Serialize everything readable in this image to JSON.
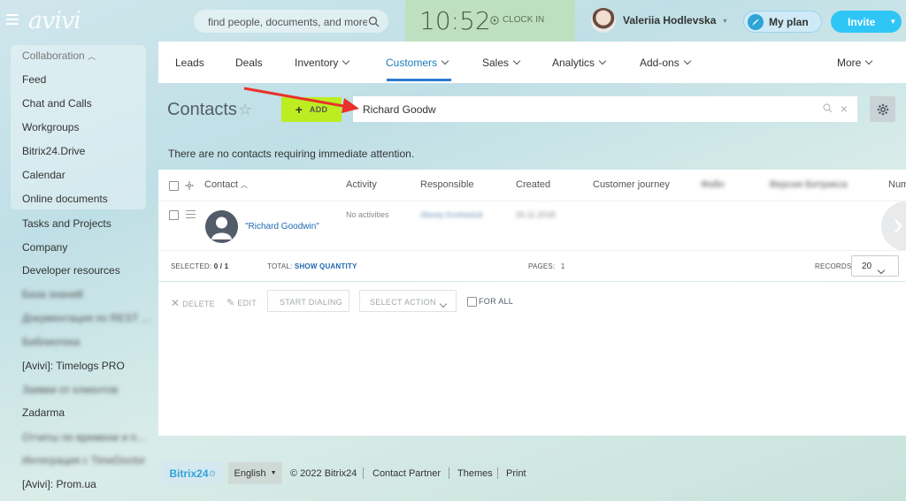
{
  "header": {
    "logo_text": "avivi",
    "search_placeholder": "find people, documents, and more",
    "clock_time": "10:52",
    "clock_in_label": "CLOCK IN",
    "user_name": "Valeriia Hodlevska",
    "plan_label": "My plan",
    "invite_label": "Invite"
  },
  "sidebar": {
    "header": "Collaboration",
    "items": [
      "Feed",
      "Chat and Calls",
      "Workgroups",
      "Bitrix24.Drive",
      "Calendar",
      "Online documents",
      "Tasks and Projects",
      "Company",
      "Developer resources",
      "База знаний",
      "Документация по REST ...",
      "Библиотека",
      "[Avivi]: Timelogs PRO",
      "Заявки от клиентов",
      "Zadarma",
      "Отчеты по времени и п...",
      "Интеграция с TimeDoctor",
      "[Avivi]: Prom.ua"
    ]
  },
  "tabs": [
    "Leads",
    "Deals",
    "Inventory",
    "Customers",
    "Sales",
    "Analytics",
    "Add-ons",
    "More"
  ],
  "page": {
    "title": "Contacts",
    "add_label": "ADD",
    "filter_value": "Richard Goodw",
    "notice": "There are no contacts requiring immediate attention."
  },
  "grid": {
    "columns": [
      "Contact",
      "Activity",
      "Responsible",
      "Created",
      "Customer journey",
      "Фейн",
      "Версия Битрикса",
      "Num"
    ],
    "rows": [
      {
        "contact": "\"Richard Goodwin\"",
        "activity": "No activities",
        "responsible": "Alexey Kovbasiuk",
        "created": "26.11.2018"
      }
    ],
    "footer": {
      "selected_label": "SELECTED:",
      "selected_value": "0 / 1",
      "total_label": "TOTAL:",
      "total_link": "SHOW QUANTITY",
      "pages_label": "PAGES:",
      "pages_value": "1",
      "records_label": "RECORDS:",
      "records_value": "20"
    }
  },
  "actions": {
    "delete": "DELETE",
    "edit": "EDIT",
    "start_dialing": "START DIALING",
    "select_action": "SELECT ACTION",
    "for_all": "FOR ALL"
  },
  "footer": {
    "logo_text": "Bitrix24",
    "language": "English",
    "copyright": "© 2022 Bitrix24",
    "links": [
      "Contact Partner",
      "Themes",
      "Print"
    ]
  },
  "colors": {
    "accent": "#2fc6f6",
    "add_button": "#bbed21",
    "clock_bg": "#bfe0c0",
    "annotation_arrow": "#e8312a"
  }
}
